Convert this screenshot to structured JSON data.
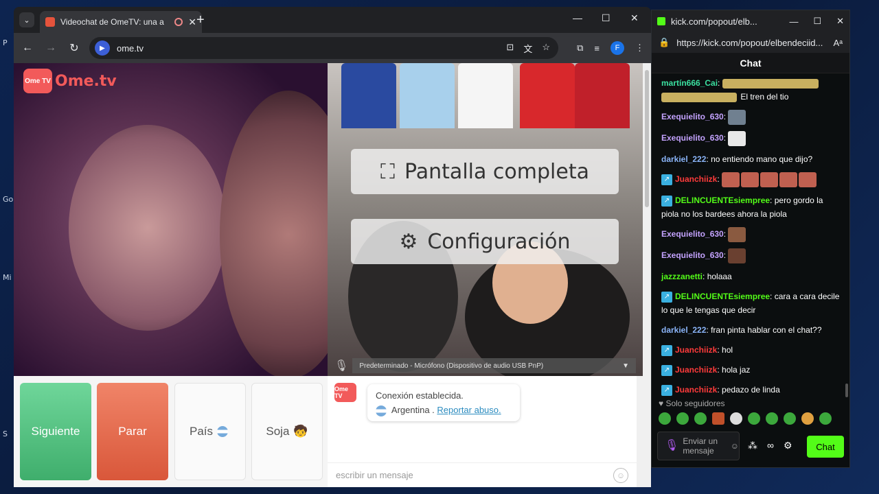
{
  "browser": {
    "tab_title": "Videochat de OmeTV: una a",
    "url": "ome.tv",
    "profile_initial": "F"
  },
  "ome": {
    "logo_box": "Ome TV",
    "logo_text": "Ome.tv",
    "overlay_fullscreen": "Pantalla completa",
    "overlay_settings": "Configuración",
    "mic_device": "Predeterminado - Micrófono (Dispositivo de audio USB PnP)",
    "btn_next": "Siguiente",
    "btn_stop": "Parar",
    "btn_country": "País",
    "btn_gender": "Soja",
    "chat_avatar": "Ome TV",
    "sys_connected": "Conexión establecida.",
    "sys_country": "Argentina .",
    "sys_report": "Reportar abuso.",
    "msg_placeholder": "escribir un mensaje"
  },
  "kick": {
    "title": "kick.com/popout/elb...",
    "url": "https://kick.com/popout/elbendeciid...",
    "header": "Chat",
    "messages": [
      {
        "user": "martín666_Cai",
        "color": "#3be0a0",
        "text": "El tren del tio"
      },
      {
        "user": "Exequielito_630",
        "color": "#c4a3ff",
        "text": ""
      },
      {
        "user": "Exequielito_630",
        "color": "#c4a3ff",
        "text": ""
      },
      {
        "user": "darkiel_222",
        "color": "#8ab4f8",
        "text": "no entiendo mano que dijo?"
      },
      {
        "user": "Juanchiizk",
        "color": "#ff3b3b",
        "text": ""
      },
      {
        "user": "DELINCUENTEsiempree",
        "color": "#53fc18",
        "text": "pero gordo la piola no los bardees ahora la piola"
      },
      {
        "user": "Exequielito_630",
        "color": "#c4a3ff",
        "text": ""
      },
      {
        "user": "Exequielito_630",
        "color": "#c4a3ff",
        "text": ""
      },
      {
        "user": "jazzzanetti",
        "color": "#53fc18",
        "text": "holaaa"
      },
      {
        "user": "DELINCUENTEsiempree",
        "color": "#53fc18",
        "text": "cara a cara decile lo que le tengas que decir"
      },
      {
        "user": "darkiel_222",
        "color": "#8ab4f8",
        "text": "fran pinta hablar con el chat??"
      },
      {
        "user": "Juanchiizk",
        "color": "#ff3b3b",
        "text": "hol"
      },
      {
        "user": "Juanchiizk",
        "color": "#ff3b3b",
        "text": "hola jaz"
      },
      {
        "user": "Juanchiizk",
        "color": "#ff3b3b",
        "text": "pedazo de linda"
      }
    ],
    "followers_only": "♥ Solo seguidores",
    "input_placeholder": "Enviar un mensaje",
    "send_label": "Chat"
  },
  "desktop_labels": [
    "P",
    "Go",
    "Mi",
    "S"
  ]
}
